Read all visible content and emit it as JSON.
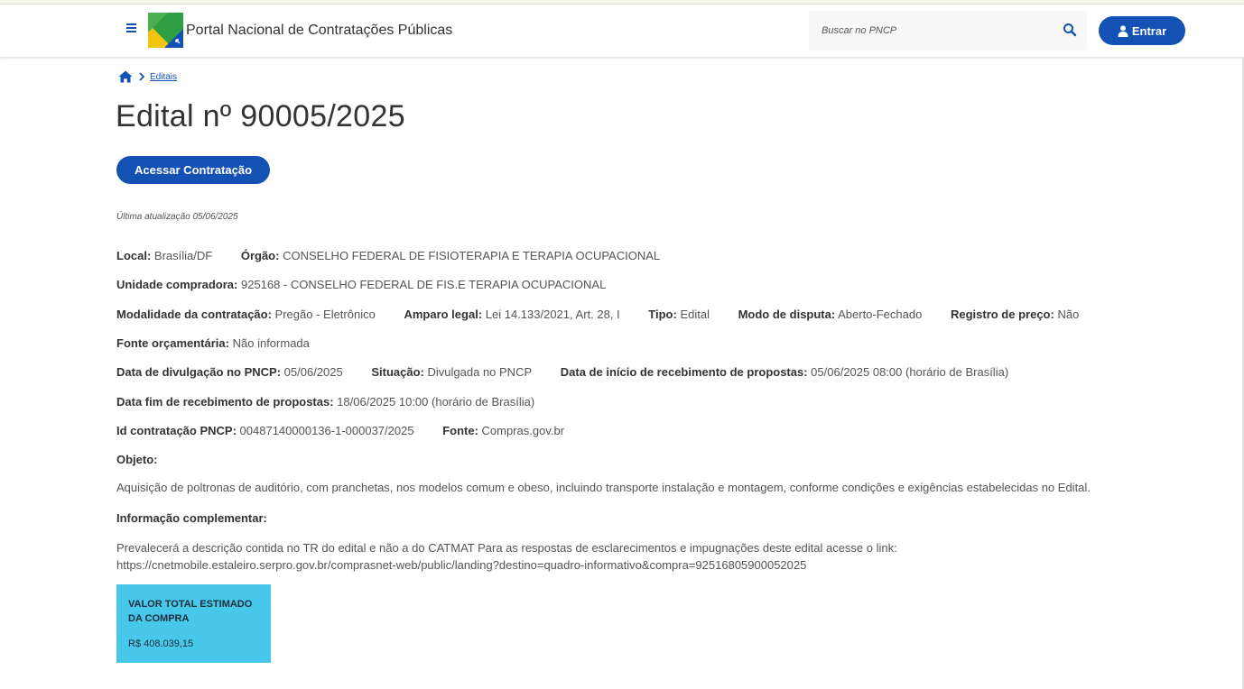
{
  "header": {
    "site_title": "Portal Nacional de Contratações Públicas",
    "search_placeholder": "Buscar no PNCP",
    "login_label": "Entrar",
    "menu_icon": "hamburger-icon",
    "search_icon": "search-icon",
    "user_icon": "user-icon"
  },
  "breadcrumb": {
    "home_icon": "home-icon",
    "item": "Editais"
  },
  "page": {
    "title": "Edital nº 90005/2025",
    "access_button": "Acessar Contratação",
    "last_updated": "Última atualização 05/06/2025"
  },
  "details": {
    "local": {
      "label": "Local:",
      "value": "Brasília/DF"
    },
    "orgao": {
      "label": "Órgão:",
      "value": "CONSELHO FEDERAL DE FISIOTERAPIA E TERAPIA OCUPACIONAL"
    },
    "unidade": {
      "label": "Unidade compradora:",
      "value": "925168 - CONSELHO FEDERAL DE FIS.E TERAPIA OCUPACIONAL"
    },
    "modalidade": {
      "label": "Modalidade da contratação:",
      "value": "Pregão - Eletrônico"
    },
    "amparo": {
      "label": "Amparo legal:",
      "value": "Lei 14.133/2021, Art. 28, I"
    },
    "tipo": {
      "label": "Tipo:",
      "value": "Edital"
    },
    "modo_disputa": {
      "label": "Modo de disputa:",
      "value": "Aberto-Fechado"
    },
    "registro_preco": {
      "label": "Registro de preço:",
      "value": "Não"
    },
    "fonte_orcamentaria": {
      "label": "Fonte orçamentária:",
      "value": "Não informada"
    },
    "data_divulgacao": {
      "label": "Data de divulgação no PNCP:",
      "value": "05/06/2025"
    },
    "situacao": {
      "label": "Situação:",
      "value": "Divulgada no PNCP"
    },
    "data_inicio": {
      "label": "Data de início de recebimento de propostas:",
      "value": "05/06/2025 08:00 (horário de Brasília)"
    },
    "data_fim": {
      "label": "Data fim de recebimento de propostas:",
      "value": "18/06/2025 10:00 (horário de Brasília)"
    },
    "id_contratacao": {
      "label": "Id contratação PNCP:",
      "value": "00487140000136-1-000037/2025"
    },
    "fonte": {
      "label": "Fonte:",
      "value": "Compras.gov.br"
    }
  },
  "objeto": {
    "label": "Objeto:",
    "text": "Aquisição de poltronas de auditório, com pranchetas, nos modelos comum e obeso, incluindo transporte instalação e montagem, conforme condições e exigências estabelecidas no Edital."
  },
  "informacao": {
    "label": "Informação complementar:",
    "line1": "Prevalecerá a descrição contida no TR do edital e não a do CATMAT Para as respostas de esclarecimentos e impugnações deste edital acesse o link:",
    "line2": "https://cnetmobile.estaleiro.serpro.gov.br/comprasnet-web/public/landing?destino=quadro-informativo&compra=92516805900052025"
  },
  "valor_card": {
    "label": "VALOR TOTAL ESTIMADO DA COMPRA",
    "value": "R$ 408.039,15",
    "color": "#47c7ea"
  },
  "colors": {
    "primary": "#1351b4",
    "text": "#333333"
  }
}
